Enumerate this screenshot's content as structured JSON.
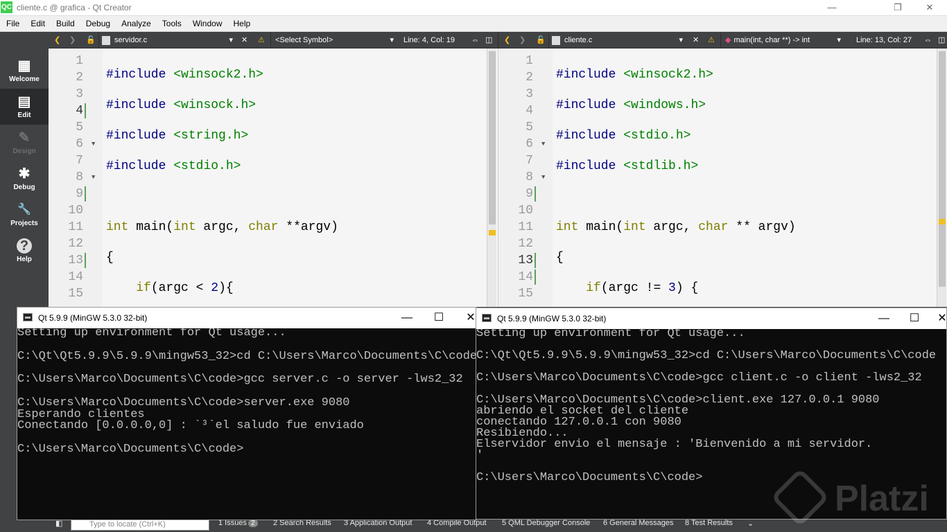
{
  "window": {
    "title": "cliente.c @ grafica - Qt Creator",
    "logo": "QC",
    "minimize": "—",
    "maximize": "❐",
    "close": "✕"
  },
  "menu": [
    "File",
    "Edit",
    "Build",
    "Debug",
    "Analyze",
    "Tools",
    "Window",
    "Help"
  ],
  "modes": [
    {
      "label": "Welcome",
      "icon": "grid-icon",
      "glyph": "▦",
      "state": "normal"
    },
    {
      "label": "Edit",
      "icon": "document-icon",
      "glyph": "▤",
      "state": "active"
    },
    {
      "label": "Design",
      "icon": "pencil-icon",
      "glyph": "✎",
      "state": "disabled"
    },
    {
      "label": "Debug",
      "icon": "bug-icon",
      "glyph": "✱",
      "state": "normal"
    },
    {
      "label": "Projects",
      "icon": "wrench-icon",
      "glyph": "🔧",
      "state": "normal"
    },
    {
      "label": "Help",
      "icon": "question-icon",
      "glyph": "?",
      "state": "normal"
    }
  ],
  "left_editor": {
    "file": "servidor.c",
    "symbol": "<Select Symbol>",
    "position": "Line: 4, Col: 19",
    "line_numbers": [
      "1",
      "2",
      "3",
      "4",
      "5",
      "6",
      "7",
      "8",
      "9",
      "10",
      "11",
      "12",
      "13",
      "14",
      "15"
    ],
    "current_line": "4"
  },
  "right_editor": {
    "file": "cliente.c",
    "symbol": "main(int, char **) -> int",
    "position": "Line: 13, Col: 27",
    "line_numbers": [
      "1",
      "2",
      "3",
      "4",
      "5",
      "6",
      "7",
      "8",
      "9",
      "10",
      "11",
      "12",
      "13",
      "14",
      "15"
    ],
    "current_line": "13"
  },
  "left_console": {
    "title": "Qt 5.9.9 (MinGW 5.3.0 32-bit)",
    "lines": [
      "Setting up environment for Qt usage...",
      "",
      "C:\\Qt\\Qt5.9.9\\5.9.9\\mingw53_32>cd C:\\Users\\Marco\\Documents\\C\\code",
      "",
      "C:\\Users\\Marco\\Documents\\C\\code>gcc server.c -o server -lws2_32",
      "",
      "C:\\Users\\Marco\\Documents\\C\\code>server.exe 9080",
      "Esperando clientes",
      "Conectando [0.0.0.0,0] : `³`el saludo fue enviado",
      "",
      "C:\\Users\\Marco\\Documents\\C\\code>"
    ]
  },
  "right_console": {
    "title": "Qt 5.9.9 (MinGW 5.3.0 32-bit)",
    "lines": [
      "Setting up environment for Qt usage...",
      "",
      "C:\\Qt\\Qt5.9.9\\5.9.9\\mingw53_32>cd C:\\Users\\Marco\\Documents\\C\\code",
      "",
      "C:\\Users\\Marco\\Documents\\C\\code>gcc client.c -o client -lws2_32",
      "",
      "C:\\Users\\Marco\\Documents\\C\\code>client.exe 127.0.0.1 9080",
      "abriendo el socket del cliente",
      "conectando 127.0.0.1 con 9080",
      "Resibiendo...",
      "Elservidor envio el mensaje : 'Bienvenido a mi servidor.",
      "'",
      "",
      "C:\\Users\\Marco\\Documents\\C\\code>"
    ]
  },
  "status": {
    "locate_placeholder": "Type to locate (Ctrl+K)",
    "issues": "1  Issues",
    "issues_count": "2",
    "search": "2  Search Results",
    "app_output": "3  Application Output",
    "compile": "4  Compile Output",
    "qml": "5  QML Debugger Console",
    "general": "6  General Messages",
    "tests": "8  Test Results"
  },
  "watermark": "Platzi",
  "colors": {
    "keyword": "#808000",
    "preprocessor": "#000080",
    "string": "#008000",
    "type": "#800080",
    "sidebar": "#404244"
  }
}
